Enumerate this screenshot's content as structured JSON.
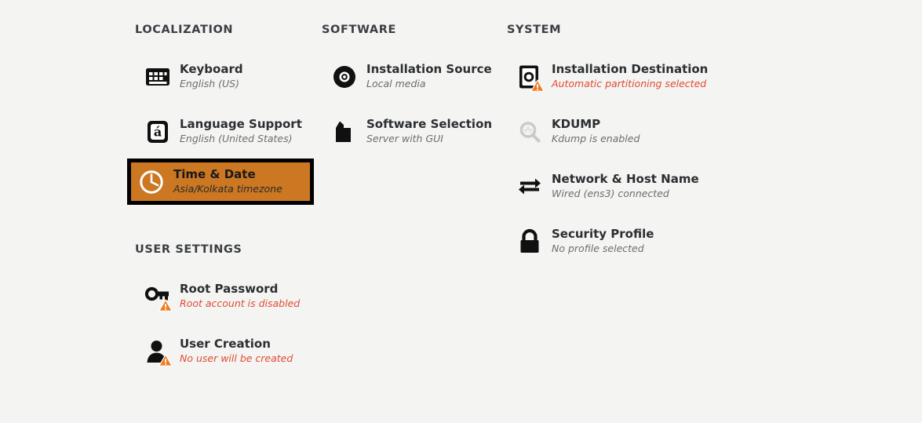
{
  "page": {
    "background_color": "#f4f4f2",
    "accent_color": "#cc7722",
    "warning_color": "#e24a33",
    "text_color": "#2b2f31",
    "status_color": "#6a6e70"
  },
  "sections": {
    "localization": {
      "title": "LOCALIZATION"
    },
    "software": {
      "title": "SOFTWARE"
    },
    "system": {
      "title": "SYSTEM"
    },
    "user_settings": {
      "title": "USER SETTINGS"
    }
  },
  "localization": {
    "items": [
      {
        "id": "keyboard",
        "title": "Keyboard",
        "status": "English (US)",
        "icon": "keyboard-icon",
        "status_state": "normal",
        "selected": false
      },
      {
        "id": "language_support",
        "title": "Language Support",
        "status": "English (United States)",
        "icon": "language-icon",
        "status_state": "normal",
        "selected": false
      },
      {
        "id": "time_date",
        "title": "Time & Date",
        "status": "Asia/Kolkata timezone",
        "icon": "clock-icon",
        "status_state": "normal",
        "selected": true
      }
    ]
  },
  "user_settings": {
    "items": [
      {
        "id": "root_password",
        "title": "Root Password",
        "status": "Root account is disabled",
        "icon": "key-icon",
        "status_state": "warning",
        "has_warning_badge": true,
        "selected": false
      },
      {
        "id": "user_creation",
        "title": "User Creation",
        "status": "No user will be created",
        "icon": "user-icon",
        "status_state": "warning",
        "has_warning_badge": true,
        "selected": false
      }
    ]
  },
  "software": {
    "items": [
      {
        "id": "installation_source",
        "title": "Installation Source",
        "status": "Local media",
        "icon": "disc-icon",
        "status_state": "normal",
        "selected": false
      },
      {
        "id": "software_selection",
        "title": "Software Selection",
        "status": "Server with GUI",
        "icon": "package-icon",
        "status_state": "normal",
        "selected": false
      }
    ]
  },
  "system": {
    "items": [
      {
        "id": "installation_destination",
        "title": "Installation Destination",
        "status": "Automatic partitioning selected",
        "icon": "harddrive-icon",
        "status_state": "warning",
        "has_warning_badge": true,
        "selected": false
      },
      {
        "id": "kdump",
        "title": "KDUMP",
        "status": "Kdump is enabled",
        "icon": "magnifier-icon",
        "status_state": "normal",
        "selected": false
      },
      {
        "id": "network_host_name",
        "title": "Network & Host Name",
        "status": "Wired (ens3) connected",
        "icon": "network-arrows-icon",
        "status_state": "normal",
        "selected": false
      },
      {
        "id": "security_profile",
        "title": "Security Profile",
        "status": "No profile selected",
        "icon": "lock-icon",
        "status_state": "normal",
        "selected": false
      }
    ]
  }
}
